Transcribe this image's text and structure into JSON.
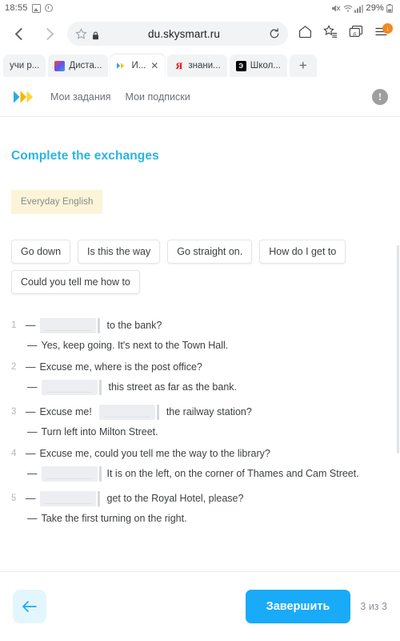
{
  "statusbar": {
    "time": "18:55",
    "battery_pct": "29%",
    "icons": [
      "image-icon",
      "alarm-icon",
      "mute-icon",
      "wifi-icon",
      "signal-icon",
      "battery-icon"
    ]
  },
  "browser": {
    "back_icon": "chevron-left-icon",
    "forward_icon": "chevron-right-icon",
    "url": "du.skysmart.ru",
    "url_star_icon": "star-icon",
    "url_lock_icon": "lock-icon",
    "url_reload_icon": "reload-icon",
    "home_icon": "home-icon",
    "bookmarks_icon": "bookmarks-star-icon",
    "tabs_icon": "tabs-icon",
    "tabs_count": "6",
    "menu_icon": "menu-icon",
    "menu_badge": "↓",
    "tabs": [
      {
        "label": "учи р...",
        "favicon": "none",
        "active": false,
        "closable": false
      },
      {
        "label": "Диста...",
        "favicon": "colorful-icon",
        "active": false,
        "closable": false
      },
      {
        "label": "И...",
        "favicon": "skysmart-icon",
        "active": true,
        "closable": true,
        "close_icon": "close-icon"
      },
      {
        "label": "знани...",
        "favicon": "yandex-icon",
        "favicon_text": "Я",
        "active": false,
        "closable": false
      },
      {
        "label": "Школ...",
        "favicon": "school-icon",
        "favicon_text": "Э",
        "active": false,
        "closable": false
      }
    ],
    "new_tab_icon": "plus-icon",
    "new_tab_label": "+"
  },
  "app_header": {
    "logo": "skysmart-play-logo",
    "links": [
      "Мои задания",
      "Мои подписки"
    ],
    "warning_icon": "exclamation-circle-icon",
    "warning_glyph": "!"
  },
  "lesson": {
    "title": "Complete the exchanges",
    "tag": "Everyday English",
    "chips": [
      "Go down",
      "Is this the way",
      "Go straight on.",
      "How do I get to",
      "Could you tell me how to"
    ],
    "exercises": [
      {
        "num": "1",
        "lines": [
          {
            "type": "blank-first",
            "dash": "—",
            "blank": true,
            "text": "to the bank?"
          },
          {
            "type": "reply",
            "dash": "—",
            "blank": false,
            "text": "Yes, keep going. It's next to the Town Hall."
          }
        ]
      },
      {
        "num": "2",
        "lines": [
          {
            "type": "plain",
            "dash": "—",
            "blank": false,
            "text": "Excuse me, where is the post office?"
          },
          {
            "type": "blank-reply",
            "dash": "—",
            "blank": true,
            "text": "this street as far as the bank."
          }
        ]
      },
      {
        "num": "3",
        "lines": [
          {
            "type": "mid-blank",
            "dash": "—",
            "pre": "Excuse me!",
            "blank": true,
            "text": "the railway station?"
          },
          {
            "type": "reply",
            "dash": "—",
            "blank": false,
            "text": "Turn left into Milton Street."
          }
        ]
      },
      {
        "num": "4",
        "lines": [
          {
            "type": "plain",
            "dash": "—",
            "blank": false,
            "text": "Excuse me, could you tell me the way to the library?"
          },
          {
            "type": "blank-reply",
            "dash": "—",
            "blank": true,
            "text": "It is on the left, on the corner of Thames and Cam Street."
          }
        ]
      },
      {
        "num": "5",
        "lines": [
          {
            "type": "blank-first",
            "dash": "—",
            "blank": true,
            "text": "get to the Royal Hotel, please?"
          },
          {
            "type": "reply",
            "dash": "—",
            "blank": false,
            "text": "Take the first turning on the right."
          }
        ]
      }
    ]
  },
  "bottom": {
    "back_icon": "arrow-left-icon",
    "finish_label": "Завершить",
    "counter": "3 из 3"
  },
  "colors": {
    "accent": "#19aaf8",
    "title": "#2ab5e0",
    "tag_bg": "#fbf4d8",
    "blank_bg": "#eceef1",
    "back_btn_bg": "#e4f6fd",
    "badge": "#f2881f"
  }
}
